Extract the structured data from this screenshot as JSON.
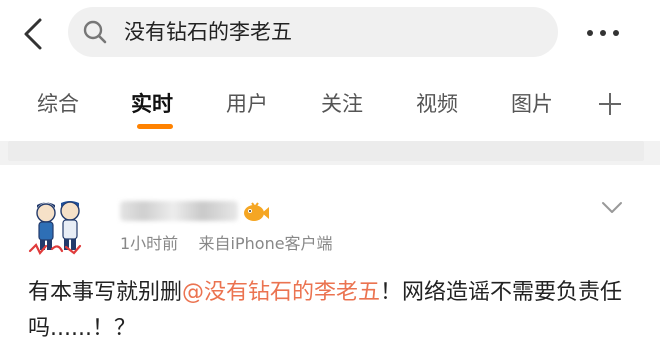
{
  "search": {
    "query": "没有钻石的李老五"
  },
  "tabs": [
    {
      "label": "综合",
      "active": false
    },
    {
      "label": "实时",
      "active": true
    },
    {
      "label": "用户",
      "active": false
    },
    {
      "label": "关注",
      "active": false
    },
    {
      "label": "视频",
      "active": false
    },
    {
      "label": "图片",
      "active": false
    }
  ],
  "icons": {
    "back": "back-chevron-icon",
    "search": "search-icon",
    "more": "more-dots-icon",
    "add_tab": "plus-icon",
    "expand": "chevron-down-icon",
    "badge": "fish-badge-icon"
  },
  "colors": {
    "accent": "#ff8200",
    "mention": "#eb7350",
    "meta": "#888888"
  },
  "post": {
    "time": "1小时前",
    "source": "来自iPhone客户端",
    "text_before": "有本事写就别删",
    "mention": "@没有钻石的李老五",
    "text_after": "！网络造谣不需要负责任吗......！？"
  }
}
